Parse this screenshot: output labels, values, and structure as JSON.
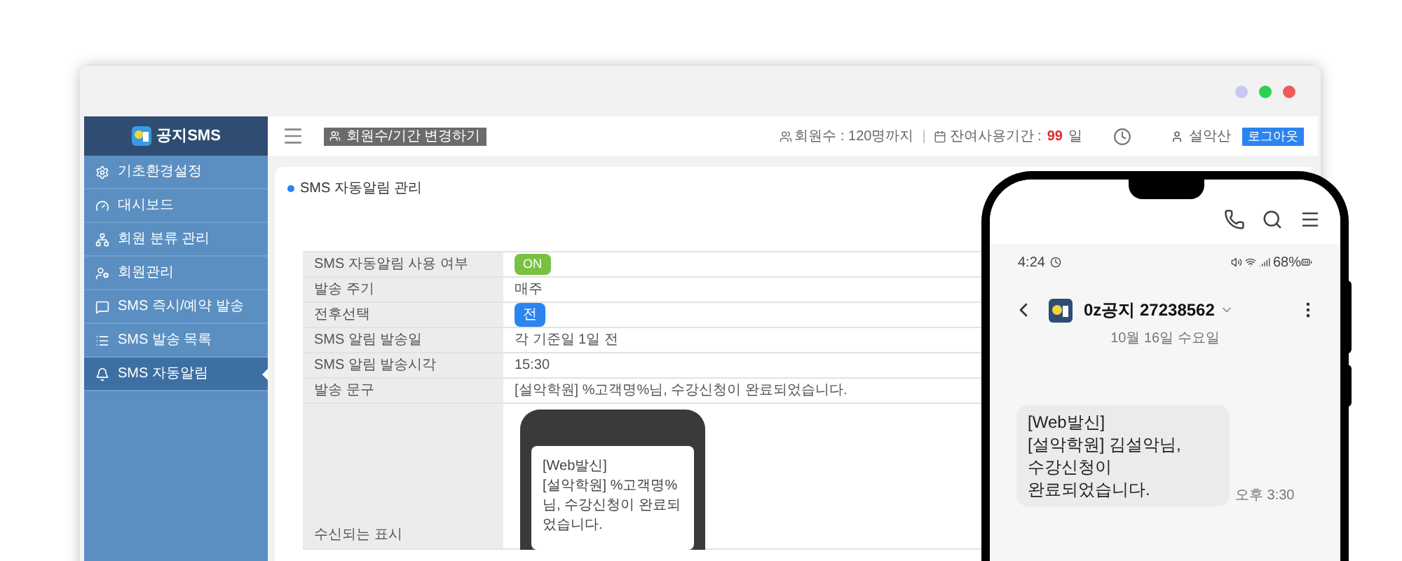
{
  "window": {
    "controls": [
      {
        "color": "#c9c8f3"
      },
      {
        "color": "#2bd14f"
      },
      {
        "color": "#f25a5a"
      }
    ]
  },
  "sidebar": {
    "logo": "공지SMS",
    "items": [
      {
        "label": "기초환경설정",
        "selected": false
      },
      {
        "label": "대시보드",
        "selected": false
      },
      {
        "label": "회원 분류 관리",
        "selected": false
      },
      {
        "label": "회원관리",
        "selected": false
      },
      {
        "label": "SMS 즉시/예약 발송",
        "selected": false
      },
      {
        "label": "SMS 발송 목록",
        "selected": false
      },
      {
        "label": "SMS 자동알림",
        "selected": true
      }
    ]
  },
  "topbar": {
    "change_button": "회원수/기간 변경하기",
    "members": "회원수 : 120명까지",
    "separator": "|",
    "period_label": "잔여사용기간 :",
    "period_value": "99",
    "period_unit": "일",
    "user": "설악산",
    "logout_button": "로그아웃"
  },
  "page": {
    "title": "SMS 자동알림 관리",
    "rows": [
      {
        "label": "SMS 자동알림 사용 여부",
        "kind": "toggle",
        "value": "ON",
        "on": true
      },
      {
        "label": "발송 주기",
        "kind": "text",
        "value": "매주"
      },
      {
        "label": "전후선택",
        "kind": "badge",
        "value": "전"
      },
      {
        "label": "SMS 알림 발송일",
        "kind": "text",
        "value": "각 기준일 1일 전"
      },
      {
        "label": "SMS 알림 발송시각",
        "kind": "text",
        "value": "15:30"
      },
      {
        "label": "발송 문구",
        "kind": "text",
        "value": "[설악학원] %고객명%님, 수강신청이 완료되었습니다."
      },
      {
        "label": "수신되는 표시",
        "kind": "preview",
        "lines": [
          "[Web발신]",
          "[설악학원]  %고객명%님, 수강신청이 완료되었습니다."
        ]
      }
    ]
  },
  "phone": {
    "time": "4:24",
    "battery": "68%",
    "contact": "0z공지 27238562",
    "date": "10월 16일 수요일",
    "message_lines": [
      "[Web발신]",
      "[설악학원]  김설악님,",
      "수강신청이",
      "완료되었습니다."
    ],
    "message_time": "오후 3:30"
  }
}
